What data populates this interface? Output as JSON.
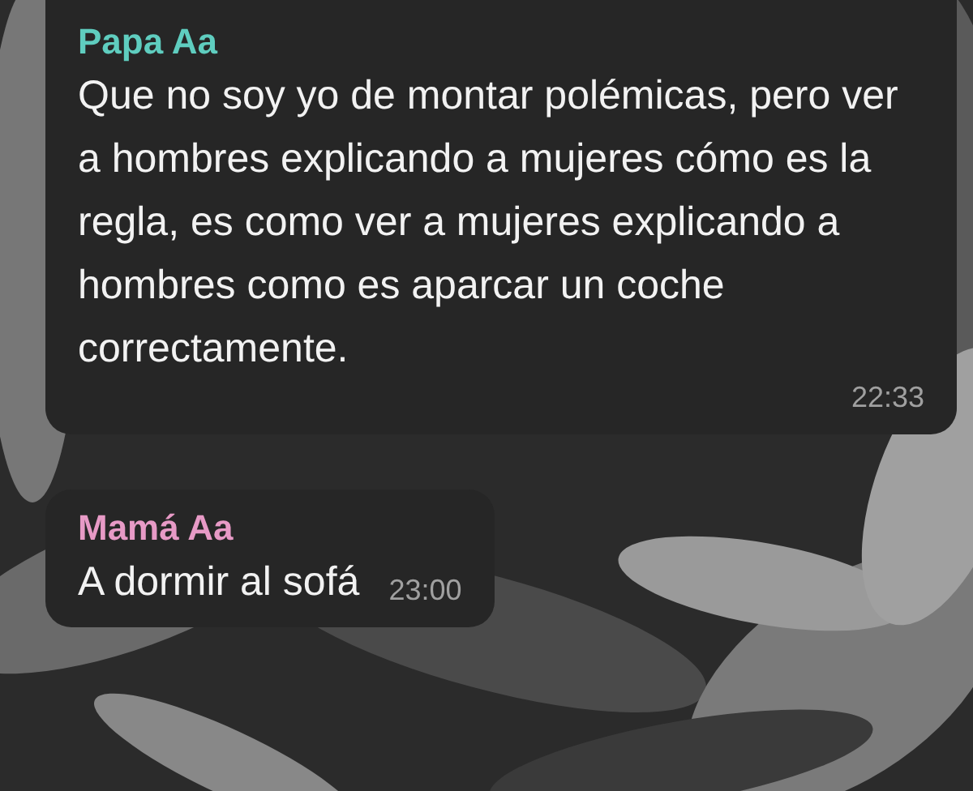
{
  "messages": [
    {
      "sender": "Papa Aa",
      "color": "#5fcdbf",
      "text": "Que no soy yo de montar polémicas, pero ver a hombres explicando a mujeres cómo es la regla, es como ver a mujeres explicando a hombres como es aparcar un coche correctamente.",
      "time": "22:33"
    },
    {
      "sender": "Mamá Aa",
      "color": "#e79ac6",
      "text": "A dormir al sofá",
      "time": "23:00"
    }
  ]
}
